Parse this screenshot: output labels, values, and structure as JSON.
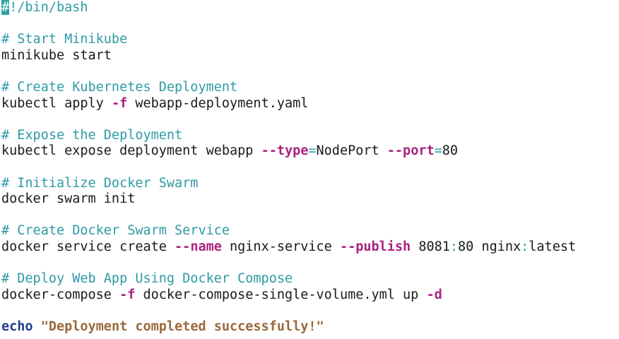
{
  "editor": {
    "lines": [
      {
        "id": "shebang",
        "segments": [
          {
            "type": "cursor",
            "text": "#"
          },
          {
            "type": "shebang",
            "text": "!/bin/bash"
          }
        ]
      },
      {
        "id": "blank1",
        "segments": []
      },
      {
        "id": "c1",
        "segments": [
          {
            "type": "comment",
            "text": "# Start Minikube"
          }
        ]
      },
      {
        "id": "l1",
        "segments": [
          {
            "type": "cmd",
            "text": "minikube start"
          }
        ]
      },
      {
        "id": "blank2",
        "segments": []
      },
      {
        "id": "c2",
        "segments": [
          {
            "type": "comment",
            "text": "# Create Kubernetes Deployment"
          }
        ]
      },
      {
        "id": "l2",
        "segments": [
          {
            "type": "cmd",
            "text": "kubectl apply "
          },
          {
            "type": "flag",
            "text": "-f"
          },
          {
            "type": "cmd",
            "text": " webapp-deployment.yaml"
          }
        ]
      },
      {
        "id": "blank3",
        "segments": []
      },
      {
        "id": "c3",
        "segments": [
          {
            "type": "comment",
            "text": "# Expose the Deployment"
          }
        ]
      },
      {
        "id": "l3",
        "segments": [
          {
            "type": "cmd",
            "text": "kubectl expose deployment webapp "
          },
          {
            "type": "flag",
            "text": "--type"
          },
          {
            "type": "op",
            "text": "="
          },
          {
            "type": "cmd",
            "text": "NodePort "
          },
          {
            "type": "flag",
            "text": "--port"
          },
          {
            "type": "op",
            "text": "="
          },
          {
            "type": "cmd",
            "text": "80"
          }
        ]
      },
      {
        "id": "blank4",
        "segments": []
      },
      {
        "id": "c4",
        "segments": [
          {
            "type": "comment",
            "text": "# Initialize Docker Swarm"
          }
        ]
      },
      {
        "id": "l4",
        "segments": [
          {
            "type": "cmd",
            "text": "docker swarm init"
          }
        ]
      },
      {
        "id": "blank5",
        "segments": []
      },
      {
        "id": "c5",
        "segments": [
          {
            "type": "comment",
            "text": "# Create Docker Swarm Service"
          }
        ]
      },
      {
        "id": "l5",
        "segments": [
          {
            "type": "cmd",
            "text": "docker service create "
          },
          {
            "type": "flag",
            "text": "--name"
          },
          {
            "type": "cmd",
            "text": " nginx-service "
          },
          {
            "type": "flag",
            "text": "--publish"
          },
          {
            "type": "cmd",
            "text": " 8081"
          },
          {
            "type": "op",
            "text": ":"
          },
          {
            "type": "cmd",
            "text": "80 nginx"
          },
          {
            "type": "op",
            "text": ":"
          },
          {
            "type": "cmd",
            "text": "latest"
          }
        ]
      },
      {
        "id": "blank6",
        "segments": []
      },
      {
        "id": "c6",
        "segments": [
          {
            "type": "comment",
            "text": "# Deploy Web App Using Docker Compose"
          }
        ]
      },
      {
        "id": "l6",
        "segments": [
          {
            "type": "cmd",
            "text": "docker-compose "
          },
          {
            "type": "flag",
            "text": "-f"
          },
          {
            "type": "cmd",
            "text": " docker-compose-single-volume.yml up "
          },
          {
            "type": "flag",
            "text": "-d"
          }
        ]
      },
      {
        "id": "blank7",
        "segments": []
      },
      {
        "id": "l7",
        "segments": [
          {
            "type": "keyword",
            "text": "echo"
          },
          {
            "type": "cmd",
            "text": " "
          },
          {
            "type": "string",
            "text": "\"Deployment completed successfully!\""
          }
        ]
      }
    ]
  },
  "colors": {
    "comment": "#2e9aa6",
    "flag": "#a8247f",
    "keyword": "#1f3f8c",
    "string": "#9a6a3c",
    "text": "#1a1a1a",
    "cursor": "#2fa3a8"
  }
}
